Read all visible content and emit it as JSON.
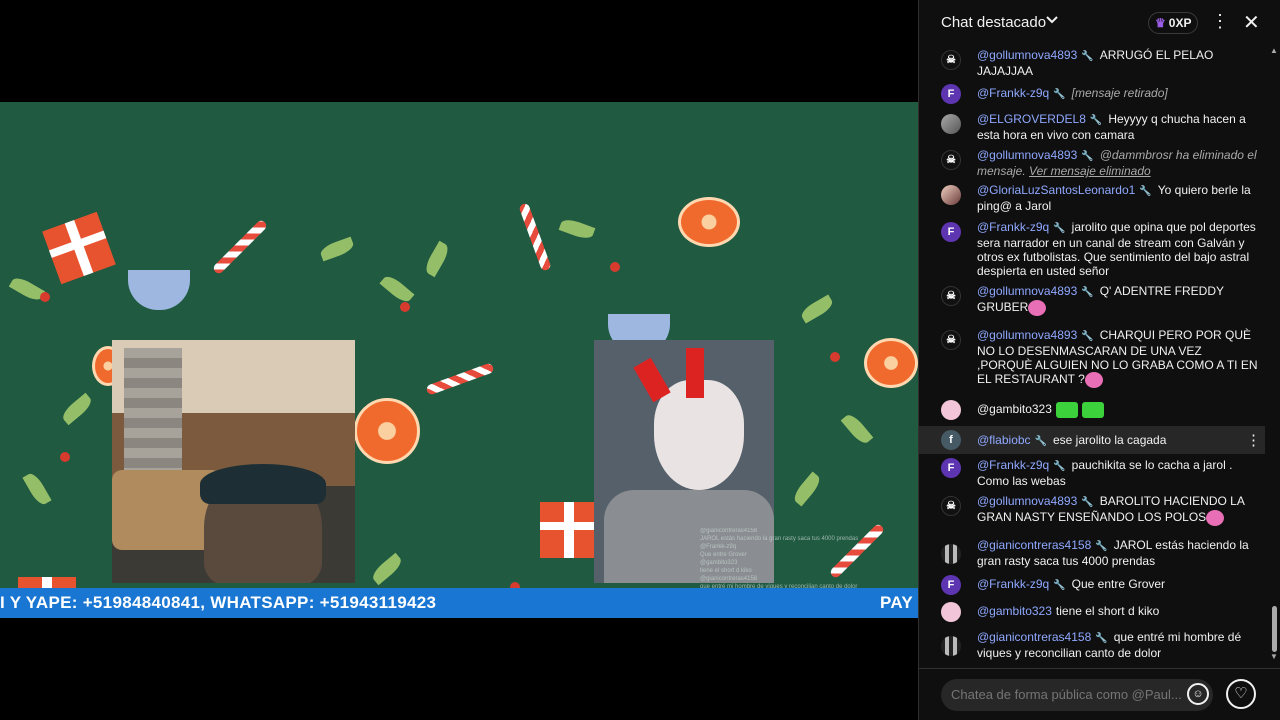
{
  "video": {
    "ticker_left": "I Y YAPE: +51984840841, WHATSAPP: +51943119423",
    "ticker_right": "PAY",
    "overlay_lines": [
      "@gianicontreras4158",
      "JAROL estás haciendo la gran rasty saca tus 4000 prendas",
      "@Frankk-z9q",
      "Que entre Grover",
      "@gambito323",
      "tiene el short d kiko",
      "@gianicontreras4158",
      "que entré mi hombre de viques y reconcilian canto de dolor"
    ]
  },
  "chat": {
    "title": "Chat destacado",
    "xp": "0XP",
    "input_placeholder": "Chatea de forma pública como @Paul...",
    "messages": [
      {
        "author": "@gollumnova4893",
        "text": "ARRUGÓ EL PELAO JAJAJJAA",
        "avatar": "skull"
      },
      {
        "author": "@Frankk-z9q",
        "text": "[mensaje retirado]",
        "avatar": "F",
        "removed": true
      },
      {
        "author": "@ELGROVERDEL8",
        "text": "Heyyyy q chucha hacen a esta hora en vivo con camara",
        "avatar": "photo"
      },
      {
        "author": "@gollumnova4893",
        "text": "@dammbrosr ha eliminado el mensaje.",
        "link": "Ver mensaje eliminado",
        "avatar": "skull",
        "removed": true
      },
      {
        "author": "@GloriaLuzSantosLeonardo1",
        "text": "Yo quiero berle la ping@ a Jarol",
        "avatar": "photo"
      },
      {
        "author": "@Frankk-z9q",
        "text": "jarolito que opina que pol deportes sera narrador en un canal de stream con Galván y otros ex futbolistas. Que sentimiento del bajo astral despierta en usted señor",
        "avatar": "F"
      },
      {
        "author": "@gollumnova4893",
        "text": "Q' ADENTRE FREDDY GRUBER",
        "avatar": "skull",
        "emote": true
      },
      {
        "author": "@gollumnova4893",
        "text": "CHARQUI PERO POR QUÈ NO LO DESENMASCARAN DE UNA VEZ ,PORQUÈ ALGUIEN NO LO GRABA COMO A TI EN EL RESTAURANT ?",
        "avatar": "skull",
        "emote": true
      },
      {
        "author": "@gambito323",
        "text": "",
        "avatar": "pink",
        "green_emotes": true
      },
      {
        "author": "@flabiobc",
        "text": "ese jarolito la cagada",
        "avatar": "f"
      },
      {
        "author": "@Frankk-z9q",
        "text": "pauchikita se lo cacha a jarol . Como las webas",
        "avatar": "F"
      },
      {
        "author": "@gollumnova4893",
        "text": "BAROLITO HACIENDO LA GRAN NASTY ENSEÑANDO LOS POLOS",
        "avatar": "skull",
        "emote": true
      },
      {
        "author": "@gianicontreras4158",
        "text": "JAROL estás haciendo la gran rasty saca tus 4000 prendas",
        "avatar": "gian"
      },
      {
        "author": "@Frankk-z9q",
        "text": "Que entre Grover",
        "avatar": "F"
      },
      {
        "author": "@gambito323",
        "text": "tiene el short d kiko",
        "avatar": "pink"
      },
      {
        "author": "@gianicontreras4158",
        "text": "que entré mi hombre dé viques y reconcilian canto de dolor",
        "avatar": "gian"
      }
    ]
  },
  "icons": {
    "crown": "crown-icon",
    "more": "more-vert-icon",
    "close": "close-icon",
    "wrench": "wrench-icon",
    "emoji": "emoji-icon",
    "heart": "heart-icon"
  },
  "colors": {
    "author": "#8fa8ff",
    "ticker": "#1976d2",
    "chat_bg": "#0f0f0f",
    "video_bg": "#1f5a41"
  }
}
